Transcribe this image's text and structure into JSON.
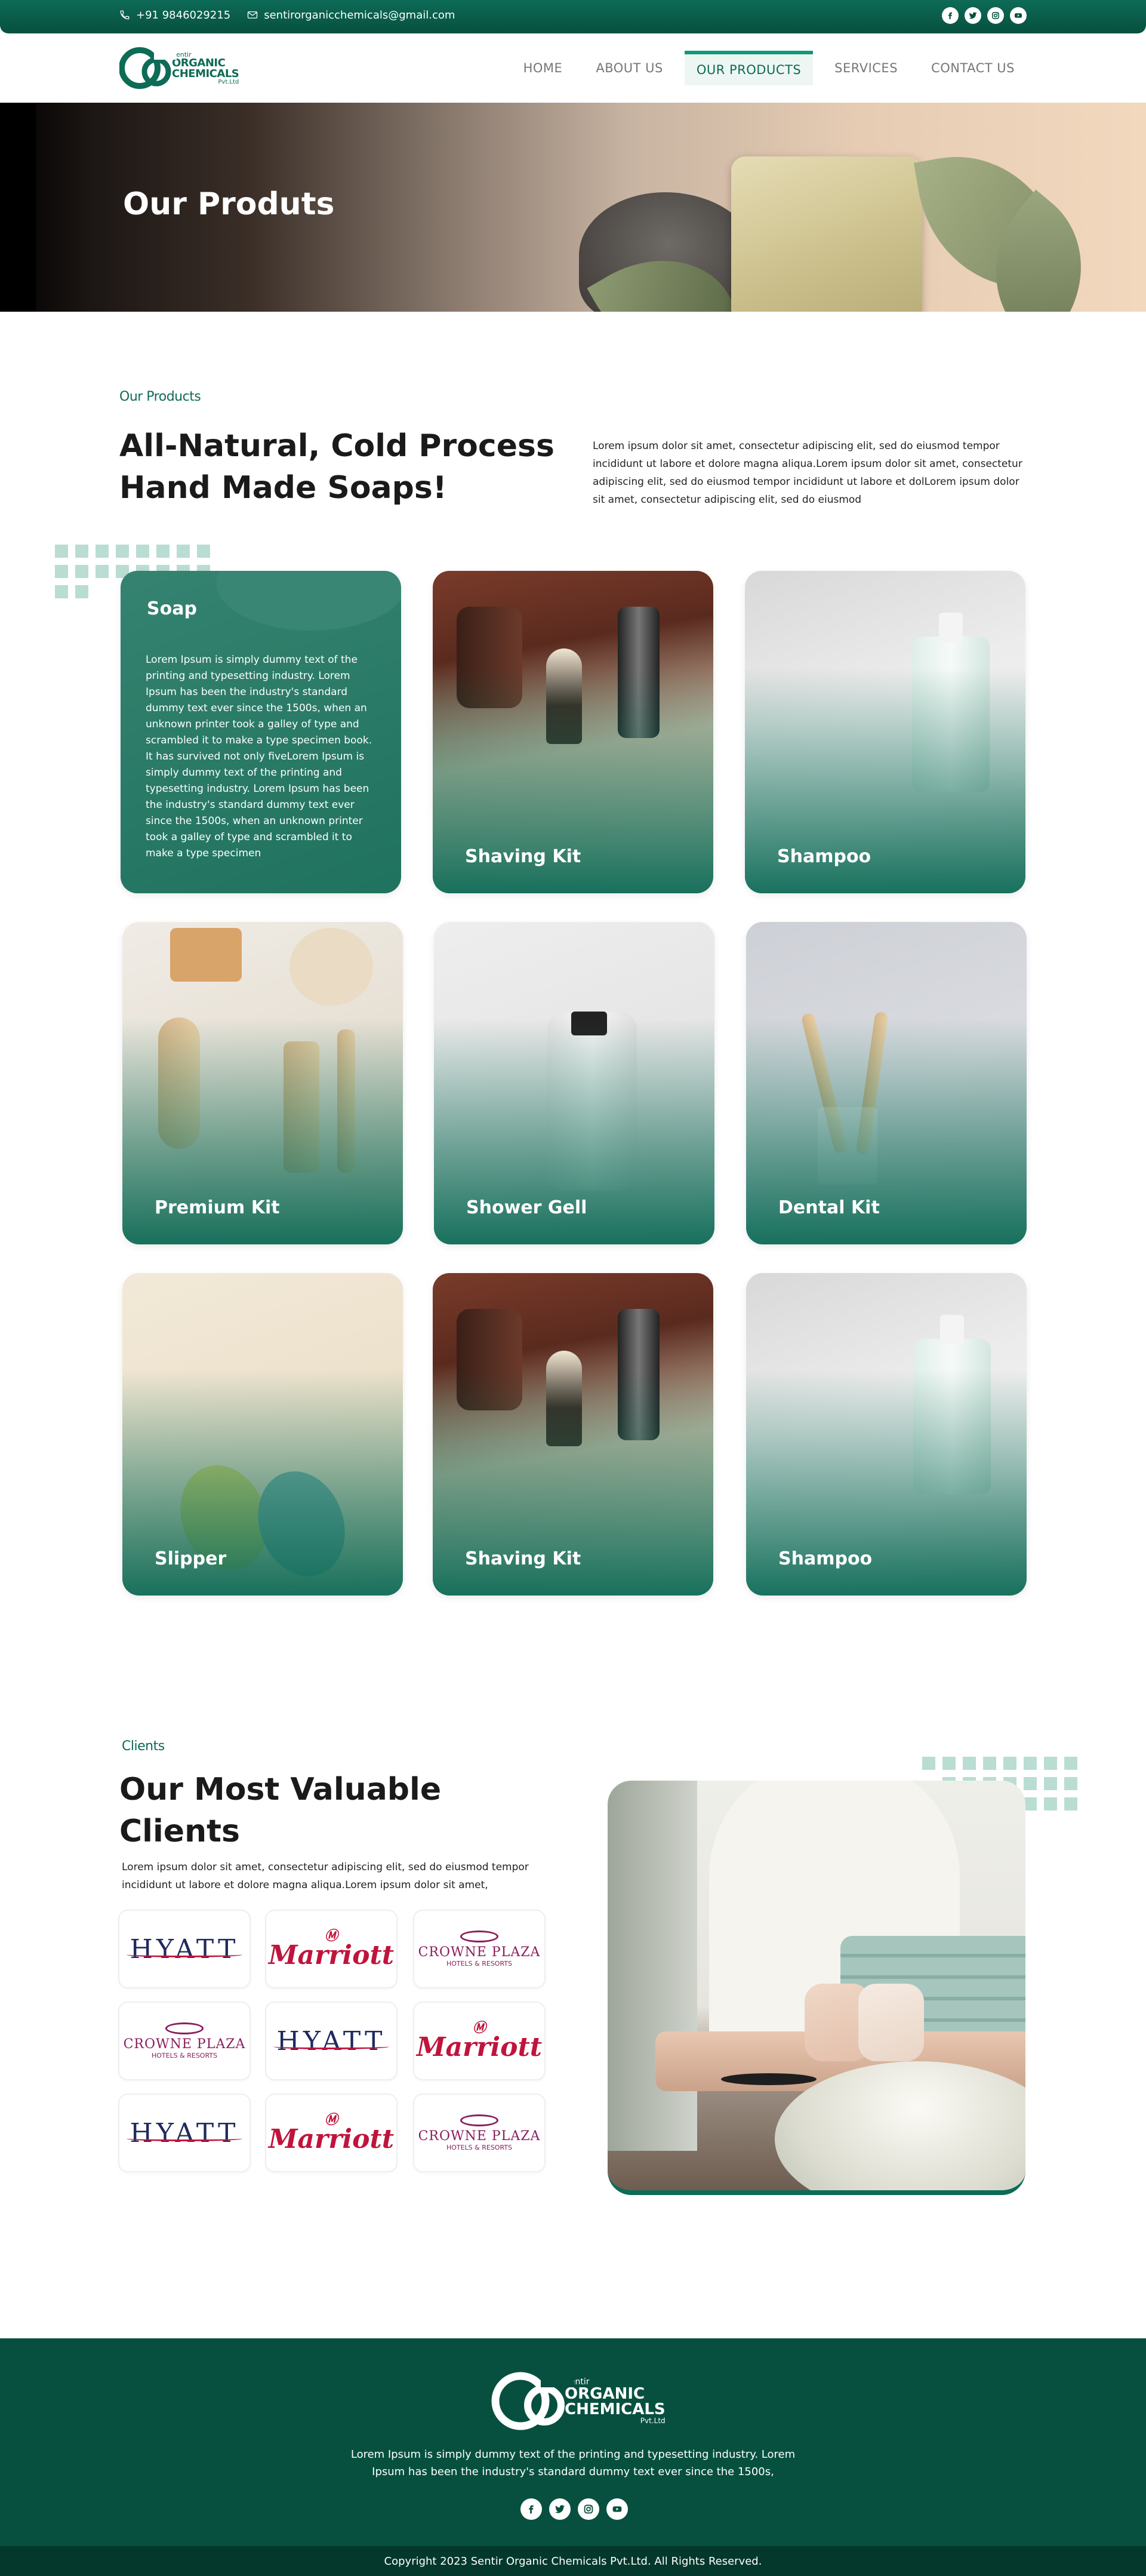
{
  "topbar": {
    "phone": "+91 9846029215",
    "email": "sentirorganicchemicals@gmail.com",
    "social": [
      "facebook-icon",
      "twitter-icon",
      "instagram-icon",
      "youtube-icon"
    ]
  },
  "brand": {
    "small": "Sentir",
    "line1": "ORGANIC",
    "line2": "CHEMICALS",
    "suffix": "Pvt.Ltd"
  },
  "nav": {
    "items": [
      "HOME",
      "ABOUT US",
      "OUR PRODUCTS",
      "SERVICES",
      "CONTACT US"
    ],
    "active": "OUR PRODUCTS"
  },
  "hero": {
    "title": "Our Produts"
  },
  "products": {
    "eyebrow": "Our Products",
    "heading": "All-Natural, Cold Process Hand Made Soaps!",
    "description": "Lorem ipsum dolor sit amet, consectetur adipiscing elit, sed do eiusmod tempor incididunt ut labore et dolore magna aliqua.Lorem ipsum dolor sit amet, consectetur adipiscing elit, sed do eiusmod tempor incididunt ut labore et dolLorem ipsum dolor sit amet, consectetur adipiscing elit, sed do eiusmod",
    "cards": [
      {
        "title": "Soap",
        "body": "Lorem Ipsum is simply dummy text of the printing and typesetting industry. Lorem Ipsum has been the industry's standard dummy text ever since the 1500s, when an unknown printer took a galley of type and scrambled it to make a type specimen book. It has survived not only fiveLorem Ipsum is simply dummy text of the printing and typesetting industry. Lorem Ipsum has been the industry's standard dummy text ever since the 1500s, when an unknown printer took a galley of type and scrambled it to make a type specimen"
      },
      {
        "title": "Shaving Kit"
      },
      {
        "title": "Shampoo"
      },
      {
        "title": "Premium Kit"
      },
      {
        "title": "Shower Gell"
      },
      {
        "title": "Dental Kit"
      },
      {
        "title": "Slipper"
      },
      {
        "title": "Shaving Kit"
      },
      {
        "title": "Shampoo"
      }
    ]
  },
  "clients": {
    "eyebrow": "Clients",
    "heading": "Our Most Valuable Clients",
    "description": "Lorem ipsum dolor sit amet, consectetur adipiscing elit, sed do eiusmod tempor incididunt ut labore et dolore magna aliqua.Lorem ipsum dolor sit amet,",
    "hyatt": "HYATT",
    "marriott": "Marriott",
    "crowne_name": "CROWNE PLAZA",
    "crowne_sub": "HOTELS & RESORTS"
  },
  "footer": {
    "description": "Lorem Ipsum is simply dummy text of the printing and typesetting industry. Lorem Ipsum has been the industry's standard dummy text ever since the 1500s,",
    "copyright": "Copyright 2023 Sentir Organic Chemicals Pvt.Ltd. All Rights Reserved."
  },
  "colors": {
    "primary": "#0d6b56",
    "dark": "#07503f",
    "accent": "#0d9b7a",
    "dots": "#b9ddd3"
  }
}
